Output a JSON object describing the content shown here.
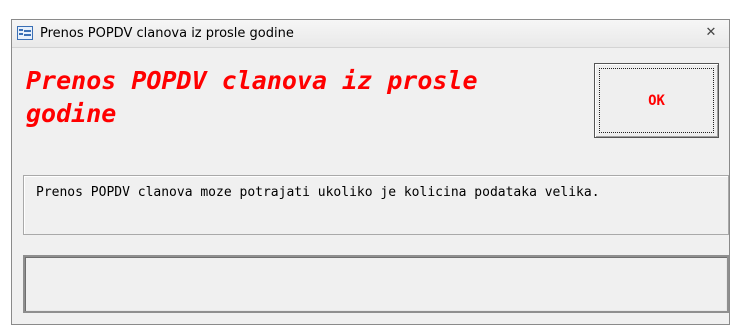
{
  "window": {
    "title": "Prenos POPDV clanova iz prosle godine",
    "icon": "access-form-icon",
    "close_glyph": "✕"
  },
  "main": {
    "heading": "Prenos POPDV clanova iz prosle godine",
    "ok_label": "OK",
    "message": "Prenos POPDV clanova moze potrajati ukoliko je kolicina podataka velika.",
    "status": ""
  },
  "colors": {
    "heading": "#ff0000",
    "ok_label": "#ff0000",
    "background": "#f0f0f0"
  }
}
